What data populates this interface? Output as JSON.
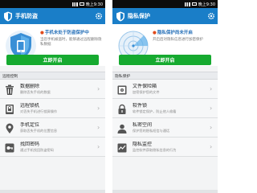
{
  "status_time": "晚上9:30",
  "left": {
    "title": "手机防盗",
    "hero_heading": "手机未处于防盗保护中",
    "hero_desc": "当您手机被盗时，能够通过远程删除隐私数据",
    "cta": "立即开启",
    "section_title": "远程控制",
    "items": [
      {
        "title": "数据删除",
        "subtitle": "删除丢失手机的数据",
        "icon": "trash-icon"
      },
      {
        "title": "远程锁机",
        "subtitle": "对丢失手机进行锁屏操作",
        "icon": "lock-icon"
      },
      {
        "title": "手机定位",
        "subtitle": "获取丢失手机的位置信息",
        "icon": "location-pin-icon"
      },
      {
        "title": "找回密码",
        "subtitle": "通过手机找回防盗密码",
        "icon": "key-icon"
      }
    ]
  },
  "right": {
    "title": "隐私保护",
    "hero_heading": "隐私保护尚未开启",
    "hero_desc": "开启后对隐私信息进行加密保护",
    "cta": "立即开启",
    "section_title": "隐私保护",
    "items": [
      {
        "title": "文件保险箱",
        "subtitle": "加密保护您的文件",
        "icon": "safe-icon"
      },
      {
        "title": "软件锁",
        "subtitle": "软件锁定保护，防止他人偷看",
        "icon": "app-lock-icon"
      },
      {
        "title": "私密空间",
        "subtitle": "保护您的隐私短信与通话",
        "icon": "private-space-icon"
      },
      {
        "title": "隐私监控",
        "subtitle": "监控软件获取隐私信息的行为",
        "icon": "monitor-icon"
      }
    ]
  },
  "colors": {
    "titlebar": "#1a7ec8",
    "cta": "#16aa30",
    "accent_blue": "#2670b8",
    "warning": "#e04b1d"
  }
}
